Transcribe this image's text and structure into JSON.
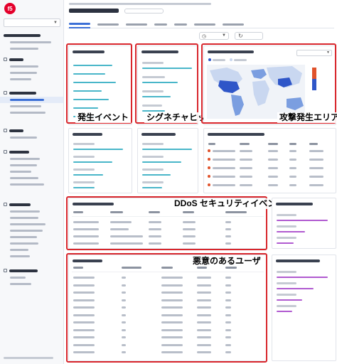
{
  "annotations": {
    "security_events": "発生イベント",
    "top_signatures": "シグネチャヒット",
    "attack_origin": "攻撃発生エリア",
    "ddos_events": "DDoS セキュリティイベント",
    "malicious_users": "悪意のあるユーザ"
  },
  "colors": {
    "highlight": "#d8262c",
    "accent": "#3b6fd6",
    "bar_teal": "#49b6c9",
    "bar_purple": "#b05ad0",
    "map_deep_blue": "#2f56c8",
    "map_land": "#c9d7f0",
    "map_ocean": "#f0f3f8",
    "event_dot": "#e0522b",
    "brand_logo": "#e4002b"
  },
  "icons": {
    "logo": "f5-logo-icon",
    "refresh": "refresh-icon",
    "calendar": "calendar-icon",
    "chevron": "chevron-down-icon"
  }
}
